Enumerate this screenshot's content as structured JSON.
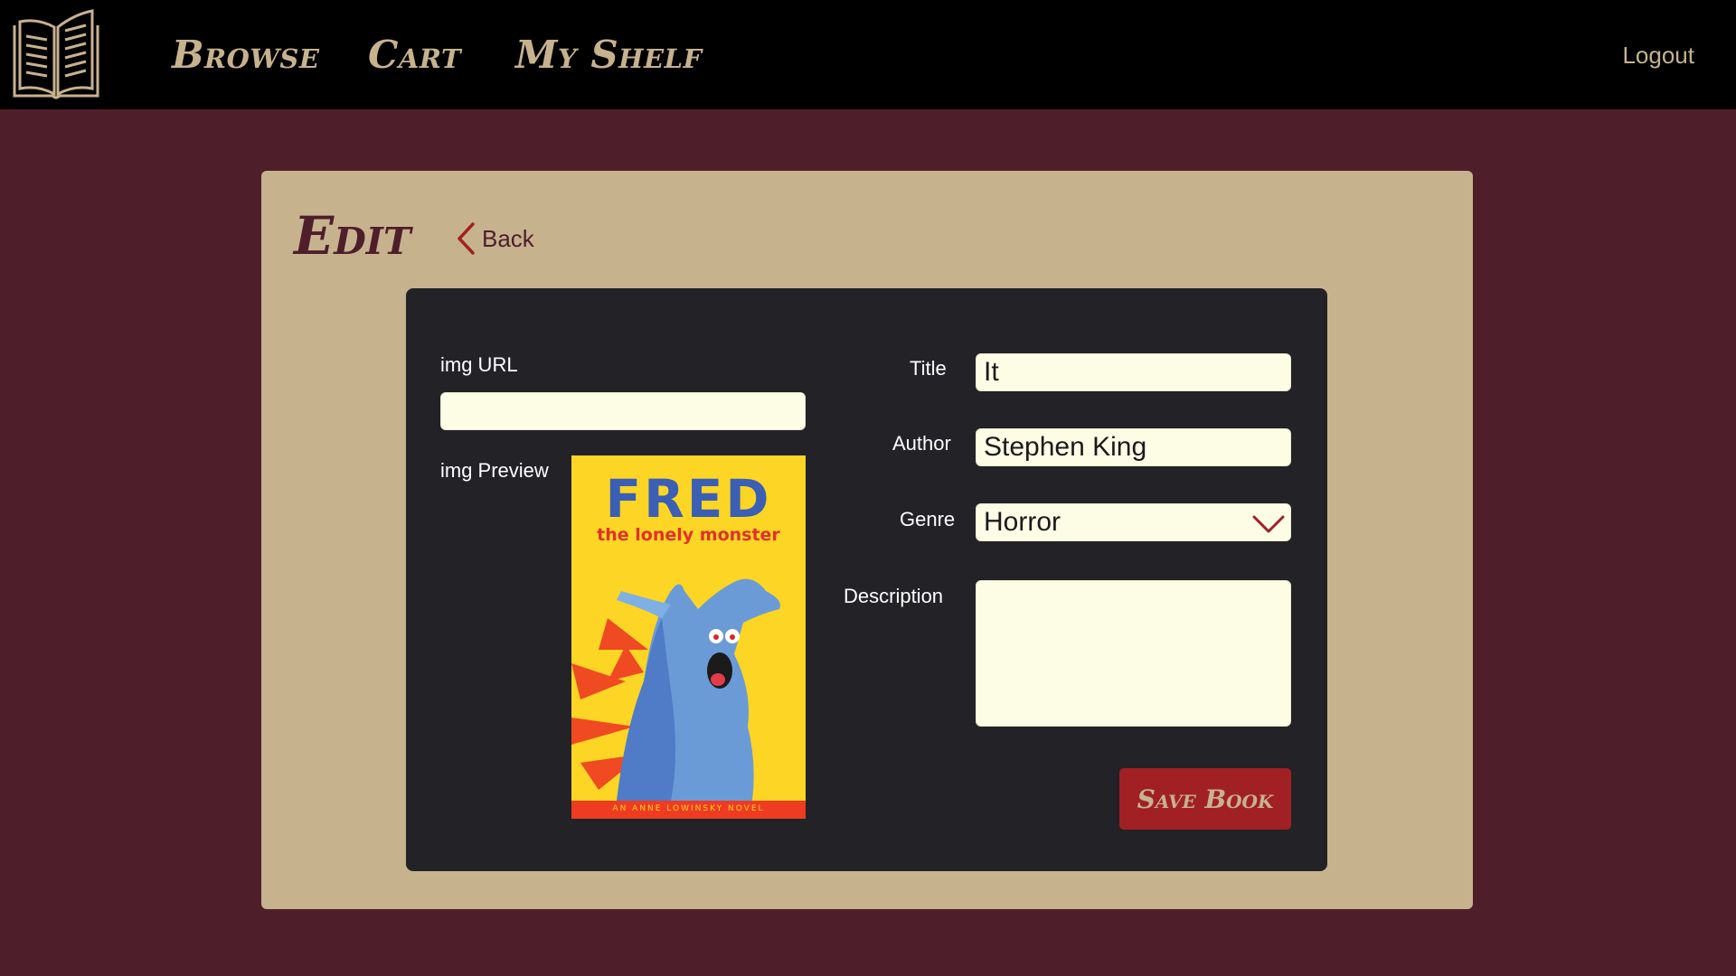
{
  "nav": {
    "logo_icon": "open-book-icon",
    "browse": "Browse",
    "cart": "Cart",
    "shelf": "My Shelf",
    "logout": "Logout"
  },
  "page": {
    "title": "Edit",
    "back_label": "Back",
    "back_icon": "chevron-left-icon"
  },
  "form": {
    "img_url_label": "img URL",
    "img_url_value": "",
    "img_preview_label": "img Preview",
    "title_label": "Title",
    "title_value": "It",
    "author_label": "Author",
    "author_value": "Stephen King",
    "genre_label": "Genre",
    "genre_value": "Horror",
    "description_label": "Description",
    "description_value": "",
    "save_label": "Save Book"
  },
  "cover": {
    "title": "FRED",
    "subtitle": "the lonely monster",
    "footer": "AN ANNE LOWINSKY NOVEL"
  },
  "colors": {
    "background": "#4e1e2b",
    "navbar": "#000000",
    "accent_tan": "#c7b28e",
    "panel": "#232226",
    "field_bg": "#fdfde6",
    "button_red": "#a12024"
  }
}
